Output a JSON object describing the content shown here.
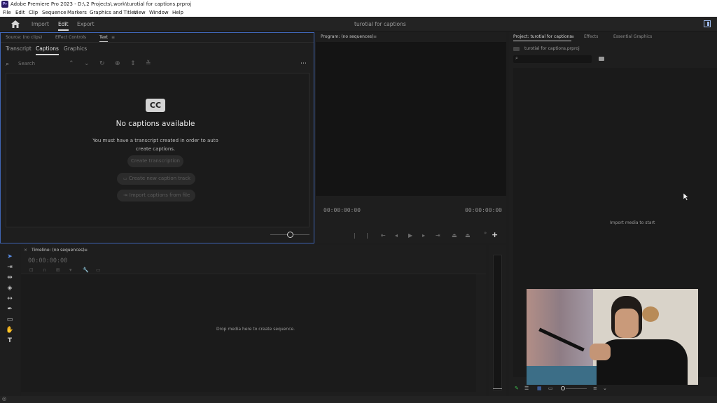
{
  "window": {
    "title": "Adobe Premiere Pro 2023 - D:\\.2 Projects\\.work\\turotial for captions.prproj",
    "app_badge": "Pr"
  },
  "menu": [
    "File",
    "Edit",
    "Clip",
    "Sequence",
    "Markers",
    "Graphics and Titles",
    "View",
    "Window",
    "Help"
  ],
  "header": {
    "import": "Import",
    "edit": "Edit",
    "export": "Export",
    "project_name": "turotial for captions"
  },
  "source_panel": {
    "tabs": {
      "source": "Source: (no clips)",
      "effect_controls": "Effect Controls",
      "text": "Text"
    },
    "subtabs": {
      "transcript": "Transcript",
      "captions": "Captions",
      "graphics": "Graphics"
    },
    "search_placeholder": "Search",
    "cc_badge": "CC",
    "empty_title": "No captions available",
    "empty_body": "You must have a transcript created in order to auto create captions.",
    "btn_create_transcription": "Create transcription",
    "btn_create_caption_track": "Create new caption track",
    "btn_import_captions": "Import captions from file"
  },
  "program_panel": {
    "tab": "Program: (no sequences)",
    "tc_left": "00:00:00:00",
    "tc_right": "00:00:00:00"
  },
  "project_panel": {
    "tabs": {
      "project": "Project: turotial for captions",
      "effects": "Effects",
      "essential_graphics": "Essential Graphics"
    },
    "file_name": "turotial for captions.prproj",
    "empty_msg": "Import media to start"
  },
  "timeline": {
    "tab": "Timeline: (no sequences)",
    "timecode": "00:00:00:00",
    "drop_msg": "Drop media here to create sequence."
  },
  "colors": {
    "accent_blue": "#4b7ed8",
    "panel_bg": "#1e1e1e"
  }
}
